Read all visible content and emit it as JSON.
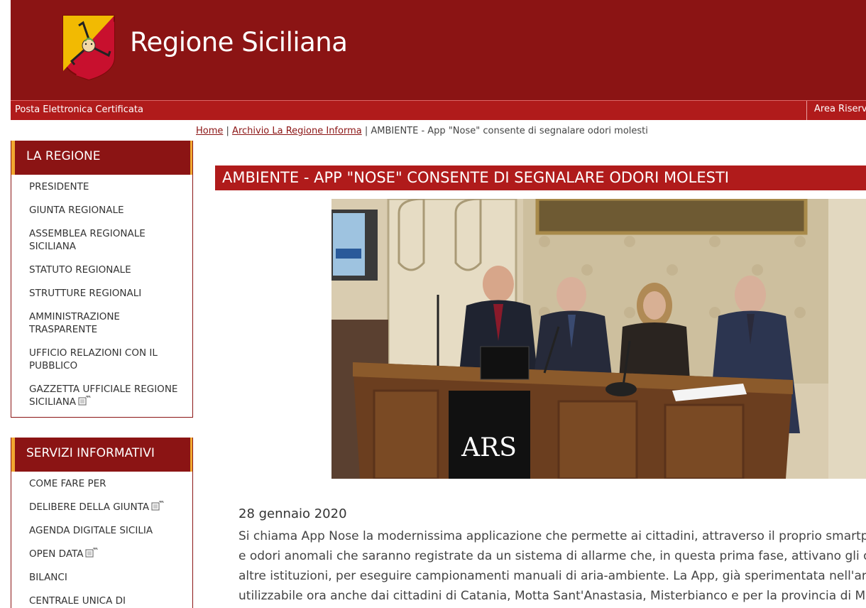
{
  "header": {
    "site_title": "Regione Siciliana",
    "logo_icon": "trinacria-coat-of-arms-icon",
    "background_color": "#8b1414"
  },
  "topbar": {
    "pec_label": "Posta Elettronica Certificata",
    "area_riservata_label": "Area Riserva",
    "background_color": "#b01b1b"
  },
  "breadcrumb": {
    "home": "Home",
    "sep1": " | ",
    "archive": "Archivio La Regione Informa",
    "sep2": " | ",
    "current": "AMBIENTE - App \"Nose\" consente di segnalare odori molesti"
  },
  "sidebar": {
    "regione": {
      "title": "LA REGIONE",
      "items": [
        {
          "label": "PRESIDENTE"
        },
        {
          "label": "GIUNTA REGIONALE"
        },
        {
          "label": "ASSEMBLEA REGIONALE SICILIANA"
        },
        {
          "label": "STATUTO REGIONALE"
        },
        {
          "label": "STRUTTURE REGIONALI"
        },
        {
          "label": "AMMINISTRAZIONE TRASPARENTE"
        },
        {
          "label": "UFFICIO RELAZIONI CON IL PUBBLICO"
        },
        {
          "label": "GAZZETTA UFFICIALE REGIONE SICILIANA",
          "icon": "external-link-icon"
        }
      ]
    },
    "servizi": {
      "title": "SERVIZI INFORMATIVI",
      "items": [
        {
          "label": "COME FARE PER"
        },
        {
          "label": "DELIBERE DELLA GIUNTA",
          "icon": "external-link-icon"
        },
        {
          "label": "AGENDA DIGITALE SICILIA"
        },
        {
          "label": "OPEN DATA",
          "icon": "external-link-icon"
        },
        {
          "label": "BILANCI"
        },
        {
          "label": "CENTRALE UNICA DI"
        }
      ]
    },
    "accent_color": "#f0a830"
  },
  "article": {
    "title": "AMBIENTE - APP \"NOSE\" CONSENTE DI SEGNALARE ODORI MOLESTI",
    "photo_desc_icon": "press-conference-photo",
    "photo_sign": "ARS",
    "date": "28 gennaio 2020",
    "body_lines": [
      "Si chiama App Nose la modernissima applicazione che permette ai cittadini, attraverso il proprio smartphone, di s",
      "e odori anomali che saranno registrate da un sistema di allarme che, in questa prima fase, attivano gli operator",
      "altre istituzioni, per eseguire campionamenti manuali di aria-ambiente. La App, già sperimentata nell'area",
      "utilizzabile ora anche dai cittadini di Catania, Motta Sant'Anastasia, Misterbianco e per la provincia di Messina i"
    ]
  }
}
